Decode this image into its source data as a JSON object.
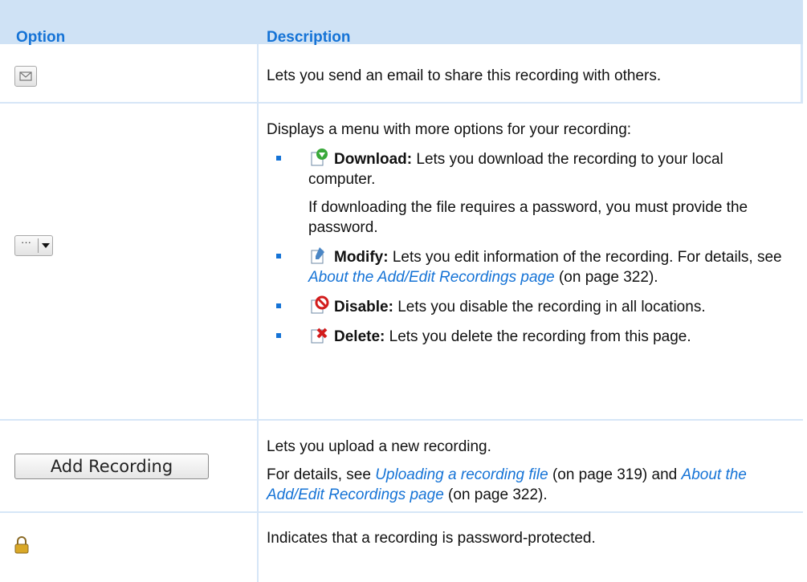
{
  "header": {
    "option": "Option",
    "description": "Description"
  },
  "rows": {
    "email": {
      "icon": "envelope-icon",
      "desc": "Lets you send an email to share this recording with others."
    },
    "more": {
      "icon": "more-options-dropdown-icon",
      "intro": "Displays a menu with more options for your recording:",
      "items": [
        {
          "icon": "download-icon",
          "title": "Download:",
          "text": "Lets you download the recording to your local computer."
        },
        {
          "icon": "modify-icon",
          "title": "Modify:",
          "text": "Lets you edit information of the recording. For details, see",
          "link": "About the Add/Edit Recordings page",
          "after": "(on page 322)."
        },
        {
          "icon": "disable-icon",
          "title": "Disable:",
          "text": "Lets you disable the recording in all locations."
        },
        {
          "icon": "delete-icon",
          "title": "Delete:",
          "text": "Lets you delete the recording from this page."
        }
      ],
      "download_note": "If downloading the file requires a password, you must provide the password."
    },
    "add": {
      "button_label": "Add Recording",
      "desc": "Lets you upload a new recording.",
      "details_prefix": "For details, see",
      "link1": "Uploading a recording file",
      "mid": "(on page 319) and",
      "link2": "About the Add/Edit Recordings page",
      "suffix": "(on page 322)."
    },
    "lock": {
      "icon": "lock-icon",
      "desc": "Indicates that a recording is password-protected."
    }
  },
  "colors": {
    "header_bg": "#cfe2f5",
    "accent": "#1573d6",
    "rule": "#d6e6f7"
  }
}
